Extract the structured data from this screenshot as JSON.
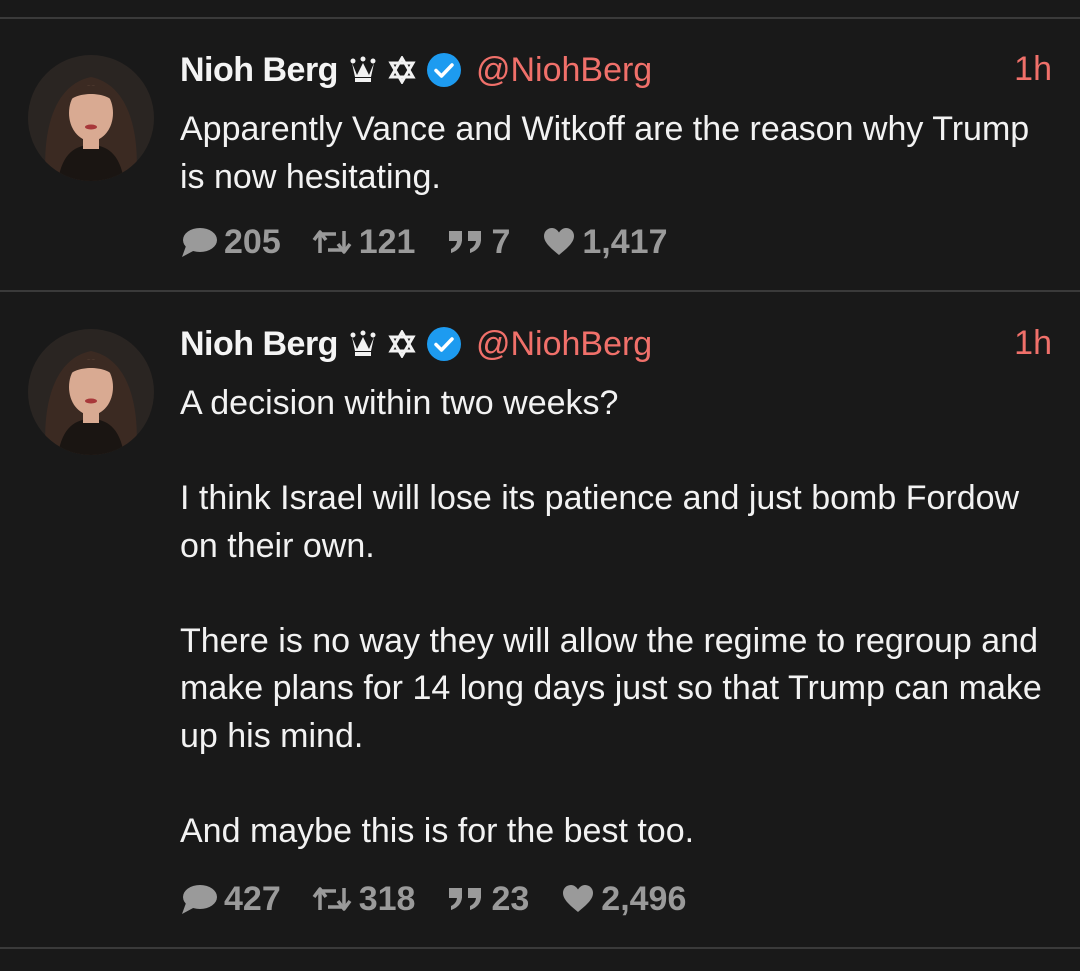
{
  "tweets": [
    {
      "author_name": "Nioh Berg",
      "badges": [
        "crown-icon",
        "star-of-david-icon",
        "verified-check-icon"
      ],
      "handle": "@NiohBerg",
      "time": "1h",
      "paragraphs": [
        "Apparently Vance and Witkoff are the reason why Trump is now hesitating."
      ],
      "replies": "205",
      "retweets": "121",
      "quotes": "7",
      "likes": "1,417"
    },
    {
      "author_name": "Nioh Berg",
      "badges": [
        "crown-icon",
        "star-of-david-icon",
        "verified-check-icon"
      ],
      "handle": "@NiohBerg",
      "time": "1h",
      "paragraphs": [
        "A decision within two weeks?",
        "I think Israel will lose its patience and just bomb Fordow on their own.",
        "There is no way they will allow the regime to regroup and make plans for 14 long days just so that Trump can make up his mind.",
        "And maybe this is for the best too."
      ],
      "replies": "427",
      "retweets": "318",
      "quotes": "23",
      "likes": "2,496"
    }
  ],
  "colors": {
    "background": "#191919",
    "text": "#f2f2f2",
    "accent_handle": "#f0706a",
    "verified_blue": "#1d9bf0",
    "action_gray": "#9a9a9a",
    "divider": "#3a3a3a"
  }
}
